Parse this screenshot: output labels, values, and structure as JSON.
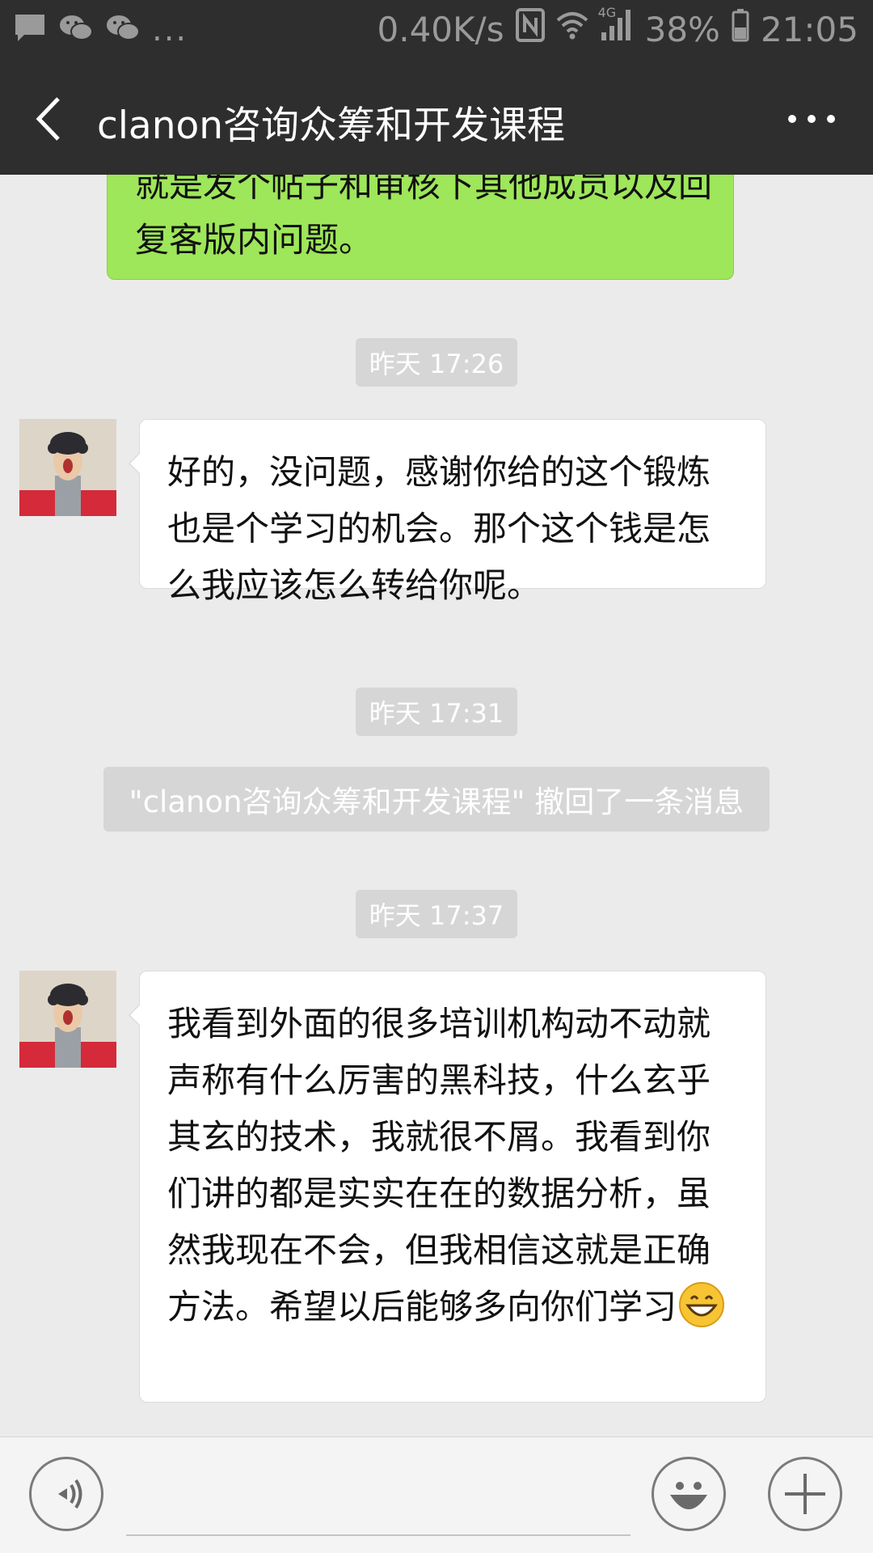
{
  "status_bar": {
    "speed": "0.40K/s",
    "network": "4G",
    "battery": "38%",
    "time": "21:05",
    "overflow_dots": "..."
  },
  "header": {
    "title": "clanon咨询众筹和开发课程"
  },
  "messages": {
    "self_partial": "就是发个帖子和审核下其他成员以及回复客版内问题。",
    "time_1": "昨天 17:26",
    "msg_1": "好的，没问题，感谢你给的这个锻炼也是个学习的机会。那个这个钱是怎么我应该怎么转给你呢。",
    "time_2": "昨天 17:31",
    "recall_notice": "\"clanon咨询众筹和开发课程\" 撤回了一条消息",
    "time_3": "昨天 17:37",
    "msg_2": "我看到外面的很多培训机构动不动就声称有什么厉害的黑科技，什么玄乎其玄的技术，我就很不屑。我看到你们讲的都是实实在在的数据分析，虽然我现在不会，但我相信这就是正确方法。希望以后能够多向你们学习"
  },
  "colors": {
    "header_bg": "#2e2e2e",
    "chat_bg": "#ebebeb",
    "self_bubble": "#9ee65a",
    "other_bubble": "#ffffff",
    "time_pill": "#d6d6d6"
  },
  "icons": [
    "message-icon",
    "wechat-icon",
    "wechat-icon",
    "nfc-icon",
    "wifi-icon",
    "signal-icon",
    "battery-icon",
    "back-icon",
    "more-icon",
    "voice-icon",
    "emoji-icon",
    "plus-icon",
    "grin-emoji-icon"
  ]
}
